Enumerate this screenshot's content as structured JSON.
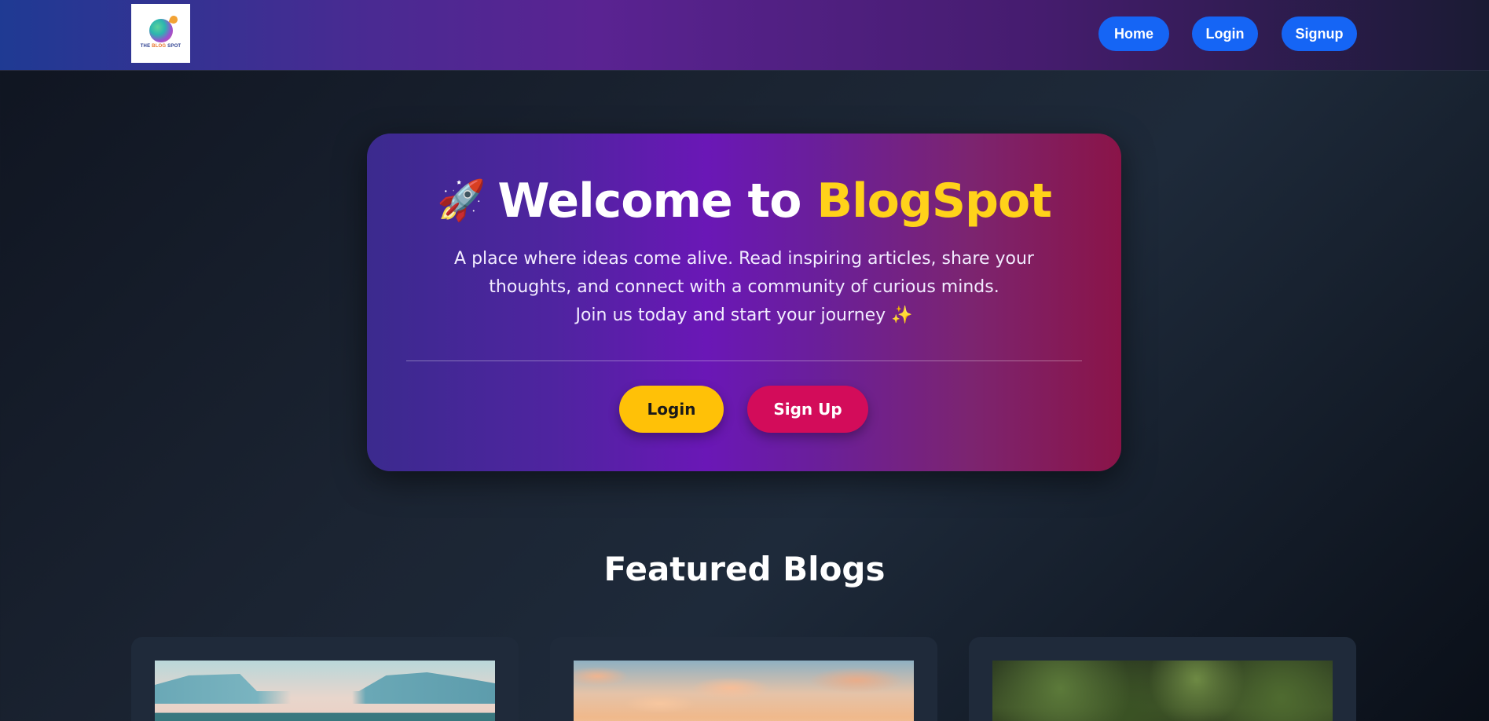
{
  "navbar": {
    "logo_text_left": "THE ",
    "logo_text_brand": "BLOG",
    "logo_text_right": " SPOT",
    "links": [
      {
        "label": "Home"
      },
      {
        "label": "Login"
      },
      {
        "label": "Signup"
      }
    ],
    "button_color": "#1565f5"
  },
  "hero": {
    "title_prefix": "Welcome to ",
    "title_brand": "BlogSpot",
    "description_line1": "A place where ideas come alive. Read inspiring articles, share your thoughts, and connect with a community of curious minds.",
    "description_line2": "Join us today and start your journey ✨",
    "login_label": "Login",
    "signup_label": "Sign Up",
    "brand_color": "#ffd21a",
    "login_color": "#ffc107",
    "signup_color": "#d30c5a"
  },
  "featured": {
    "title": "Featured Blogs",
    "cards": [
      {
        "image": "mountain-forest-sunrise"
      },
      {
        "image": "sunset-clouds-sky"
      },
      {
        "image": "dense-green-forest"
      }
    ]
  }
}
